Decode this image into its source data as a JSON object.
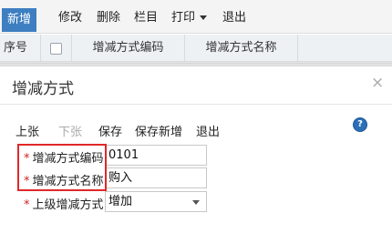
{
  "toolbar": {
    "add": "新增",
    "edit": "修改",
    "delete": "删除",
    "columns": "栏目",
    "print": "打印",
    "exit": "退出"
  },
  "list": {
    "col_seq": "序号",
    "col_code": "增减方式编码",
    "col_name": "增减方式名称"
  },
  "dialog": {
    "title": "增减方式",
    "close": "×",
    "toolbar": {
      "prev": "上张",
      "next": "下张",
      "save": "保存",
      "save_new": "保存新增",
      "exit": "退出",
      "help": "?"
    },
    "fields": {
      "code_label": "增减方式编码",
      "code_value": "0101",
      "name_label": "增减方式名称",
      "name_value": "购入",
      "parent_label": "上级增减方式",
      "parent_value": "增加",
      "required_mark": "*"
    }
  }
}
